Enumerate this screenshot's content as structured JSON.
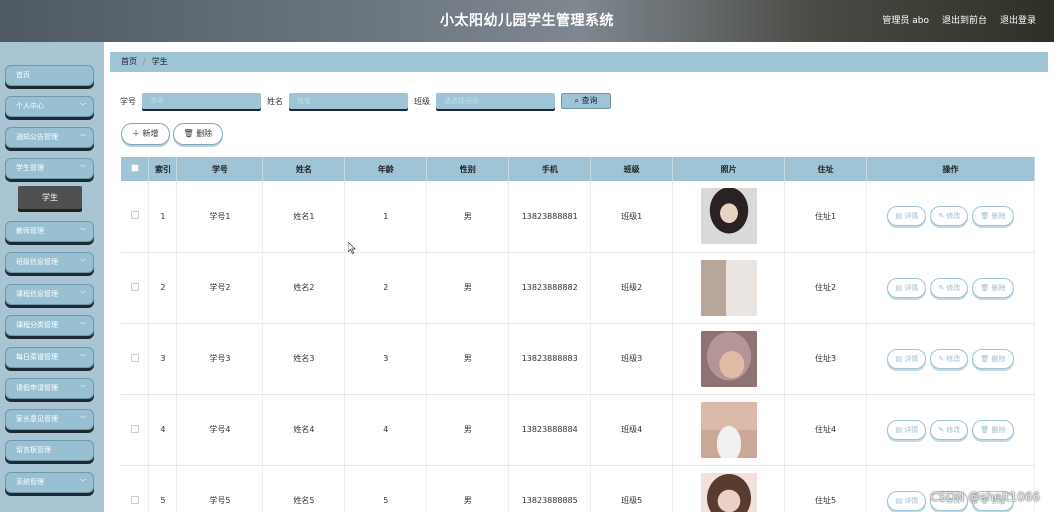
{
  "header": {
    "title": "小太阳幼儿园学生管理系统",
    "admin": "管理员 abo",
    "front_link": "退出到前台",
    "logout": "退出登录"
  },
  "sidebar": {
    "items": [
      {
        "label": "首页",
        "has_chevron": false
      },
      {
        "label": "个人中心",
        "has_chevron": true
      },
      {
        "label": "通知公告管理",
        "has_chevron": true
      },
      {
        "label": "学生管理",
        "has_chevron": true
      },
      {
        "label": "教师管理",
        "has_chevron": true
      },
      {
        "label": "班级信息管理",
        "has_chevron": true
      },
      {
        "label": "课程信息管理",
        "has_chevron": true
      },
      {
        "label": "课程分类管理",
        "has_chevron": true
      },
      {
        "label": "每日菜谱管理",
        "has_chevron": true
      },
      {
        "label": "请假申请管理",
        "has_chevron": true
      },
      {
        "label": "家长意见管理",
        "has_chevron": true
      },
      {
        "label": "留言板管理",
        "has_chevron": false
      },
      {
        "label": "系统管理",
        "has_chevron": true
      }
    ],
    "active_sub": "学生"
  },
  "breadcrumb": {
    "home": "首页",
    "sep": "/",
    "current": "学生"
  },
  "search": {
    "id_label": "学号",
    "id_placeholder": "学号",
    "name_label": "姓名",
    "name_placeholder": "姓名",
    "class_label": "班级",
    "class_placeholder": "请选择班级",
    "button": "查询"
  },
  "actions": {
    "add": "新增",
    "delete": "删除"
  },
  "table": {
    "headers": [
      "索引",
      "学号",
      "姓名",
      "年龄",
      "性别",
      "手机",
      "班级",
      "照片",
      "住址",
      "操作"
    ],
    "ops": {
      "detail": "详情",
      "edit": "修改",
      "delete": "删除"
    },
    "rows": [
      {
        "index": "1",
        "id": "学号1",
        "name": "姓名1",
        "age": "1",
        "gender": "男",
        "phone": "13823888881",
        "class": "班级1",
        "addr": "住址1"
      },
      {
        "index": "2",
        "id": "学号2",
        "name": "姓名2",
        "age": "2",
        "gender": "男",
        "phone": "13823888882",
        "class": "班级2",
        "addr": "住址2"
      },
      {
        "index": "3",
        "id": "学号3",
        "name": "姓名3",
        "age": "3",
        "gender": "男",
        "phone": "13823888883",
        "class": "班级3",
        "addr": "住址3"
      },
      {
        "index": "4",
        "id": "学号4",
        "name": "姓名4",
        "age": "4",
        "gender": "男",
        "phone": "13823888884",
        "class": "班级4",
        "addr": "住址4"
      },
      {
        "index": "5",
        "id": "学号5",
        "name": "姓名5",
        "age": "5",
        "gender": "男",
        "phone": "13823888885",
        "class": "班级5",
        "addr": "住址5"
      }
    ]
  },
  "watermark": "CSDN @shejt1066"
}
